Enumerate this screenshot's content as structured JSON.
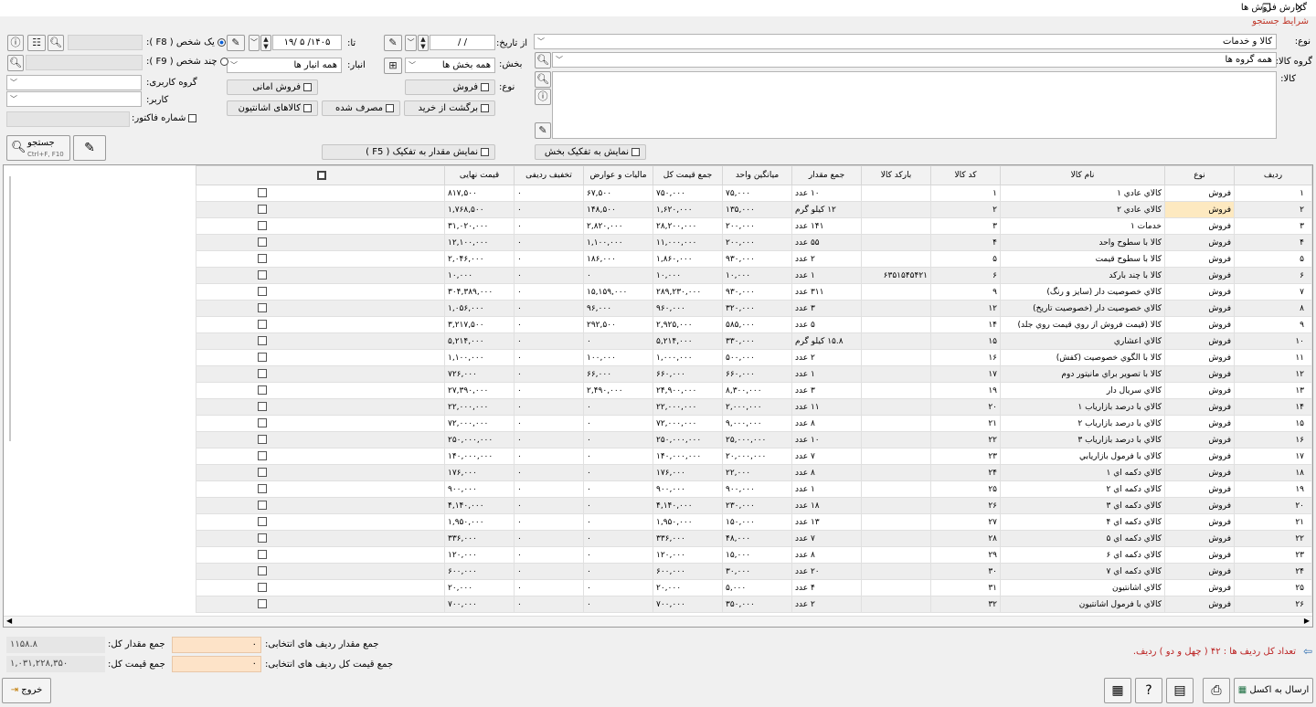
{
  "window": {
    "title": "گزارش فروش ها",
    "restore_glyph": "❐",
    "close_glyph": "✕"
  },
  "search": {
    "section_title": "شرایط جستجو",
    "type_label": "نوع:",
    "type_value": "کالا و خدمات",
    "goods_group_label": "گروه کالا:",
    "goods_group_value": "همه گروه ها",
    "goods_label": "کالا:",
    "from_date_label": "از تاریخ:",
    "from_date_value": "/  /",
    "to_label": "تا:",
    "to_date_value": "۱۴۰۵/ ۵ /۱۹",
    "branch_label": "بخش:",
    "branch_value": "همه بخش ها",
    "warehouse_label": "انبار:",
    "warehouse_value": "همه انبار ها",
    "kind_label": "نوع:",
    "sale_label": "فروش",
    "trust_sale_label": "فروش امانی",
    "purchase_return_label": "برگشت از خرید",
    "consumed_label": "مصرف شده",
    "trust_goods_label": "کالاهای اشانتیون",
    "one_person_label": "یک شخص ( F8 ):",
    "multi_person_label": "چند شخص ( F9 ):",
    "user_group_label": "گروه کاربری:",
    "user_label": "کاربر:",
    "invoice_no_label": "شماره فاکتور:",
    "search_btn": "جستجو",
    "search_shortcut": "Ctrl+F, F10",
    "show_by_branch": "نمایش به تفکیک بخش",
    "show_qty_detail": "نمایش مقدار به تفکیک ( F5 )"
  },
  "table": {
    "headers": [
      "ردیف",
      "نوع",
      "نام کالا",
      "کد کالا",
      "بارکد کالا",
      "جمع مقدار",
      "میانگین واحد",
      "جمع قیمت کل",
      "مالیات و عوارض",
      "تخفیف ردیفی",
      "قیمت نهایی"
    ],
    "rows": [
      [
        "۱",
        "فروش",
        "كالاي عادي ۱",
        "۱",
        "",
        "۱۰ عدد",
        "۷۵,۰۰۰",
        "۷۵۰,۰۰۰",
        "۶۷,۵۰۰",
        "۰",
        "۸۱۷,۵۰۰"
      ],
      [
        "۲",
        "فروش",
        "كالاي عادي ۲",
        "۲",
        "",
        "۱۲ کیلو گرم",
        "۱۳۵,۰۰۰",
        "۱,۶۲۰,۰۰۰",
        "۱۴۸,۵۰۰",
        "۰",
        "۱,۷۶۸,۵۰۰"
      ],
      [
        "۳",
        "فروش",
        "خدمات ۱",
        "۳",
        "",
        "۱۴۱ عدد",
        "۲۰۰,۰۰۰",
        "۲۸,۲۰۰,۰۰۰",
        "۲,۸۲۰,۰۰۰",
        "۰",
        "۳۱,۰۲۰,۰۰۰"
      ],
      [
        "۴",
        "فروش",
        "كالا با سطوح واحد",
        "۴",
        "",
        "۵۵ عدد",
        "۲۰۰,۰۰۰",
        "۱۱,۰۰۰,۰۰۰",
        "۱,۱۰۰,۰۰۰",
        "۰",
        "۱۲,۱۰۰,۰۰۰"
      ],
      [
        "۵",
        "فروش",
        "كالا با سطوح قيمت",
        "۵",
        "",
        "۲ عدد",
        "۹۳۰,۰۰۰",
        "۱,۸۶۰,۰۰۰",
        "۱۸۶,۰۰۰",
        "۰",
        "۲,۰۴۶,۰۰۰"
      ],
      [
        "۶",
        "فروش",
        "كالا با چند باركد",
        "۶",
        "۶۳۵۱۵۴۵۴۲۱",
        "۱ عدد",
        "۱۰,۰۰۰",
        "۱۰,۰۰۰",
        "۰",
        "۰",
        "۱۰,۰۰۰"
      ],
      [
        "۷",
        "فروش",
        "كالاي خصوصيت دار (سایز و رنگ)",
        "۹",
        "",
        "۳۱۱ عدد",
        "۹۳۰,۰۰۰",
        "۲۸۹,۲۳۰,۰۰۰",
        "۱۵,۱۵۹,۰۰۰",
        "۰",
        "۳۰۴,۳۸۹,۰۰۰"
      ],
      [
        "۸",
        "فروش",
        "كالاي خصوصيت دار (خصوصیت تاریخ)",
        "۱۲",
        "",
        "۳ عدد",
        "۳۲۰,۰۰۰",
        "۹۶۰,۰۰۰",
        "۹۶,۰۰۰",
        "۰",
        "۱,۰۵۶,۰۰۰"
      ],
      [
        "۹",
        "فروش",
        "كالا (قيمت فروش از روي قيمت روي جلد)",
        "۱۴",
        "",
        "۵ عدد",
        "۵۸۵,۰۰۰",
        "۲,۹۲۵,۰۰۰",
        "۲۹۲,۵۰۰",
        "۰",
        "۳,۲۱۷,۵۰۰"
      ],
      [
        "۱۰",
        "فروش",
        "كالاي اعشاري",
        "۱۵",
        "",
        "۱۵.۸ کیلو گرم",
        "۳۳۰,۰۰۰",
        "۵,۲۱۴,۰۰۰",
        "۰",
        "۰",
        "۵,۲۱۴,۰۰۰"
      ],
      [
        "۱۱",
        "فروش",
        "كالا با الگوي خصوصيت (كفش)",
        "۱۶",
        "",
        "۲ عدد",
        "۵۰۰,۰۰۰",
        "۱,۰۰۰,۰۰۰",
        "۱۰۰,۰۰۰",
        "۰",
        "۱,۱۰۰,۰۰۰"
      ],
      [
        "۱۲",
        "فروش",
        "كالا با تصوير براي مانيتور دوم",
        "۱۷",
        "",
        "۱ عدد",
        "۶۶۰,۰۰۰",
        "۶۶۰,۰۰۰",
        "۶۶,۰۰۰",
        "۰",
        "۷۲۶,۰۰۰"
      ],
      [
        "۱۳",
        "فروش",
        "كالاي سريال دار",
        "۱۹",
        "",
        "۳ عدد",
        "۸,۳۰۰,۰۰۰",
        "۲۴,۹۰۰,۰۰۰",
        "۲,۴۹۰,۰۰۰",
        "۰",
        "۲۷,۳۹۰,۰۰۰"
      ],
      [
        "۱۴",
        "فروش",
        "كالاي با درصد بازارياب ۱",
        "۲۰",
        "",
        "۱۱ عدد",
        "۲,۰۰۰,۰۰۰",
        "۲۲,۰۰۰,۰۰۰",
        "۰",
        "۰",
        "۲۲,۰۰۰,۰۰۰"
      ],
      [
        "۱۵",
        "فروش",
        "كالاي با درصد بازارياب ۲",
        "۲۱",
        "",
        "۸ عدد",
        "۹,۰۰۰,۰۰۰",
        "۷۲,۰۰۰,۰۰۰",
        "۰",
        "۰",
        "۷۲,۰۰۰,۰۰۰"
      ],
      [
        "۱۶",
        "فروش",
        "كالاي با درصد بازارياب ۳",
        "۲۲",
        "",
        "۱۰ عدد",
        "۲۵,۰۰۰,۰۰۰",
        "۲۵۰,۰۰۰,۰۰۰",
        "۰",
        "۰",
        "۲۵۰,۰۰۰,۰۰۰"
      ],
      [
        "۱۷",
        "فروش",
        "كالاي با فرمول بازاريابي",
        "۲۳",
        "",
        "۷ عدد",
        "۲۰,۰۰۰,۰۰۰",
        "۱۴۰,۰۰۰,۰۰۰",
        "۰",
        "۰",
        "۱۴۰,۰۰۰,۰۰۰"
      ],
      [
        "۱۸",
        "فروش",
        "كالاي دكمه اي ۱",
        "۲۴",
        "",
        "۸ عدد",
        "۲۲,۰۰۰",
        "۱۷۶,۰۰۰",
        "۰",
        "۰",
        "۱۷۶,۰۰۰"
      ],
      [
        "۱۹",
        "فروش",
        "كالاي دكمه اي ۲",
        "۲۵",
        "",
        "۱ عدد",
        "۹۰۰,۰۰۰",
        "۹۰۰,۰۰۰",
        "۰",
        "۰",
        "۹۰۰,۰۰۰"
      ],
      [
        "۲۰",
        "فروش",
        "كالاي دكمه اي ۳",
        "۲۶",
        "",
        "۱۸ عدد",
        "۲۳۰,۰۰۰",
        "۴,۱۴۰,۰۰۰",
        "۰",
        "۰",
        "۴,۱۴۰,۰۰۰"
      ],
      [
        "۲۱",
        "فروش",
        "كالاي دكمه اي ۴",
        "۲۷",
        "",
        "۱۳ عدد",
        "۱۵۰,۰۰۰",
        "۱,۹۵۰,۰۰۰",
        "۰",
        "۰",
        "۱,۹۵۰,۰۰۰"
      ],
      [
        "۲۲",
        "فروش",
        "كالاي دكمه اي ۵",
        "۲۸",
        "",
        "۷ عدد",
        "۴۸,۰۰۰",
        "۳۳۶,۰۰۰",
        "۰",
        "۰",
        "۳۳۶,۰۰۰"
      ],
      [
        "۲۳",
        "فروش",
        "كالاي دكمه اي ۶",
        "۲۹",
        "",
        "۸ عدد",
        "۱۵,۰۰۰",
        "۱۲۰,۰۰۰",
        "۰",
        "۰",
        "۱۲۰,۰۰۰"
      ],
      [
        "۲۴",
        "فروش",
        "كالاي دكمه اي ۷",
        "۳۰",
        "",
        "۲۰ عدد",
        "۳۰,۰۰۰",
        "۶۰۰,۰۰۰",
        "۰",
        "۰",
        "۶۰۰,۰۰۰"
      ],
      [
        "۲۵",
        "فروش",
        "كالاي اشانتيون",
        "۳۱",
        "",
        "۴ عدد",
        "۵,۰۰۰",
        "۲۰,۰۰۰",
        "۰",
        "۰",
        "۲۰,۰۰۰"
      ],
      [
        "۲۶",
        "فروش",
        "كالاي با فرمول اشانتيون",
        "۳۲",
        "",
        "۲ عدد",
        "۳۵۰,۰۰۰",
        "۷۰۰,۰۰۰",
        "۰",
        "۰",
        "۷۰۰,۰۰۰"
      ]
    ]
  },
  "footer": {
    "total_qty_label": "جمع مقدار کل:",
    "total_qty_value": "۱۱۵۸.۸",
    "total_price_label": "جمع قیمت کل:",
    "total_price_value": "۱,۰۳۱,۲۲۸,۳۵۰",
    "sel_qty_label": "جمع مقدار ردیف های انتخابی:",
    "sel_qty_value": "۰",
    "sel_price_label": "جمع قیمت کل ردیف های انتخابی:",
    "sel_price_value": "۰",
    "row_count_text": "تعداد کل ردیف ها : ۴۲ ( چهل و دو ) ردیف.",
    "excel_btn": "ارسال به اکسل",
    "exit_btn": "خروج"
  },
  "colors": {
    "accent_red": "#c0392b",
    "highlight": "#fde9c0",
    "peach": "#fde3c8",
    "primary_blue": "#0a5fd6"
  }
}
